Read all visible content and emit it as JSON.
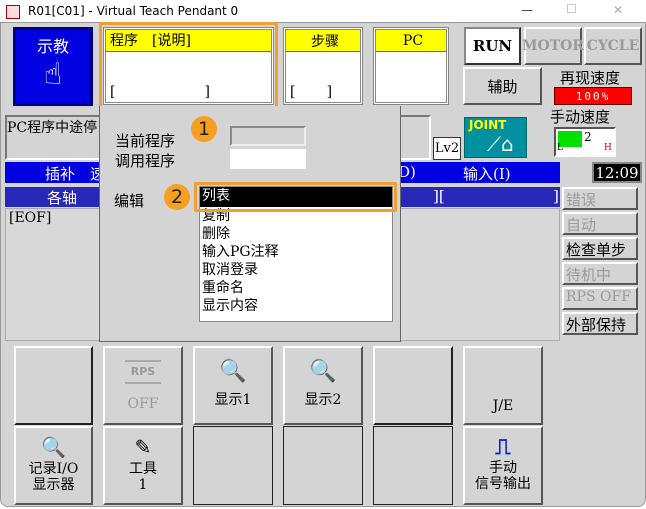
{
  "window": {
    "title": "R01[C01] - Virtual Teach Pendant 0",
    "min": "—",
    "max": "☐",
    "close": "✕"
  },
  "teach": {
    "label": "示教",
    "icon": "hand-pointer-icon"
  },
  "program_box": {
    "header": "程序　[说明]",
    "bracket": "[                    ]"
  },
  "step_box": {
    "header": "步骤",
    "bracket": "[       ]"
  },
  "pc_box": {
    "header": "PC"
  },
  "modes": {
    "run": "RUN",
    "motor": "MOTOR",
    "cycle": "CYCLE"
  },
  "aux": "辅助",
  "replay_speed": {
    "label": "再现速度",
    "value": "100%",
    "color": "#ff0000"
  },
  "manual_speed": {
    "label": "手动速度",
    "value": "2",
    "low": "L",
    "high": "H"
  },
  "joint": "JOINT",
  "lv": "Lv2",
  "pc_status": "PC程序中途停",
  "row1": {
    "a": "插补　速",
    "b": "D)",
    "c": "输入(I)"
  },
  "row2": {
    "a": "各轴",
    "b": "][",
    "c": "]"
  },
  "clock": "12:09",
  "eof": "[EOF]",
  "popup": {
    "current_label": "当前程序",
    "call_label": "调用程序",
    "edit_label": "编辑",
    "step1": "1",
    "step2": "2",
    "items": [
      "列表",
      "复制",
      "删除",
      "输入PG注释",
      "取消登录",
      "重命名",
      "显示内容"
    ]
  },
  "status": [
    "错误",
    "自动",
    "检查单步",
    "待机中",
    "RPS OFF",
    "外部保持"
  ],
  "bottom": {
    "rps": "RPS",
    "off": "OFF",
    "disp1": "显示1",
    "disp2": "显示2",
    "je": "J/E",
    "log_io_1": "记录I/O",
    "log_io_2": "显示器",
    "tool_1": "工具",
    "tool_2": "1",
    "manual_out_1": "手动",
    "manual_out_2": "信号输出"
  }
}
